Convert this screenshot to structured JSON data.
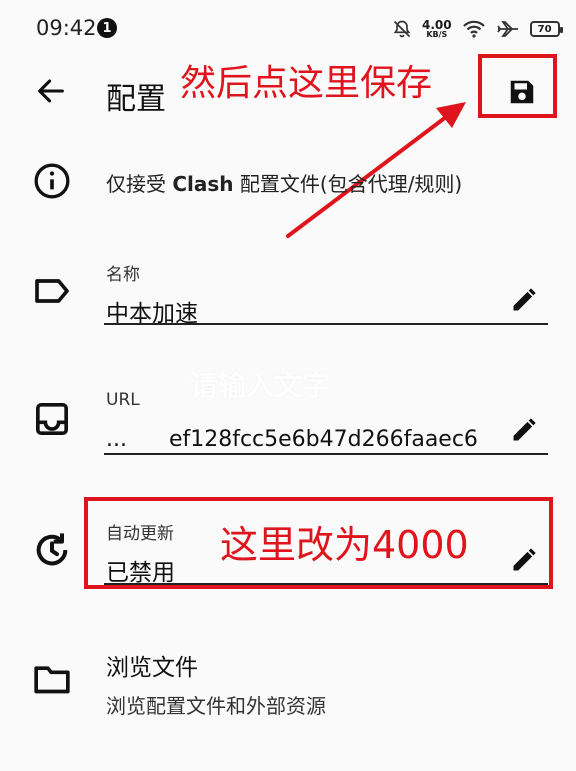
{
  "status_bar": {
    "time": "09:42",
    "notification_count": "1",
    "net_speed_value": "4.00",
    "net_speed_unit": "KB/S",
    "battery": "70"
  },
  "app_bar": {
    "title": "配置"
  },
  "annotations": {
    "top_instruction": "然后点这里保存",
    "middle_instruction": "这里改为4000",
    "color": "#e0141c"
  },
  "info": {
    "prefix": "仅接受 ",
    "bold": "Clash",
    "suffix": " 配置文件(包含代理/规则)"
  },
  "fields": {
    "name": {
      "label": "名称",
      "value": "中本加速"
    },
    "url": {
      "label": "URL",
      "value": "...      ef128fcc5e6b47d266faaec6"
    },
    "auto_update": {
      "label": "自动更新",
      "value": "已禁用"
    }
  },
  "watermark": "请输入文字",
  "browse": {
    "title": "浏览文件",
    "subtitle": "浏览配置文件和外部资源"
  }
}
